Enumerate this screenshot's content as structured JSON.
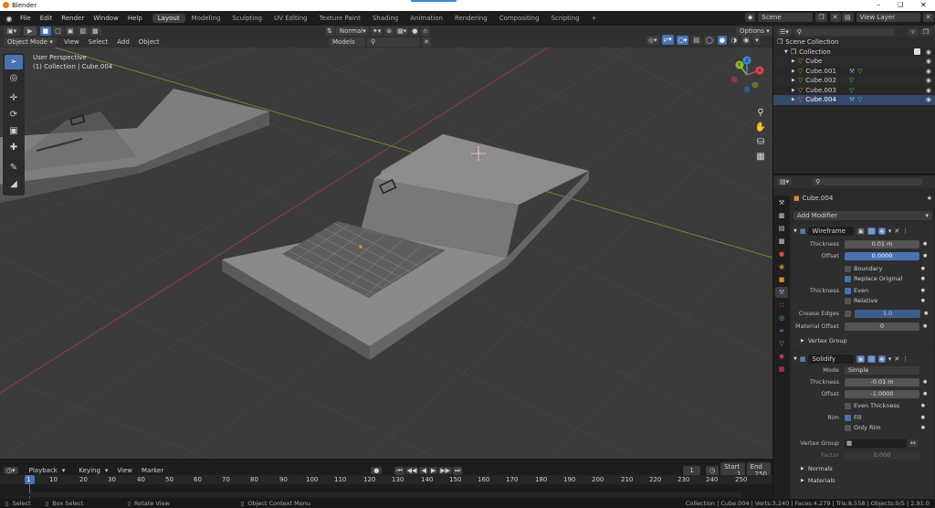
{
  "window": {
    "title": "Blender"
  },
  "topbar": {
    "menus": [
      "File",
      "Edit",
      "Render",
      "Window",
      "Help"
    ],
    "workspaces": [
      "Layout",
      "Modeling",
      "Sculpting",
      "UV Editing",
      "Texture Paint",
      "Shading",
      "Animation",
      "Rendering",
      "Compositing",
      "Scripting"
    ],
    "active_workspace": "Layout",
    "add_tab": "+",
    "scene": "Scene",
    "view_layer": "View Layer"
  },
  "viewport_header": {
    "mode": "Object Mode",
    "menus": [
      "View",
      "Select",
      "Add",
      "Object"
    ],
    "orientation": "Normal",
    "snap_target": "Models",
    "options": "Options"
  },
  "viewport": {
    "perspective_label": "User Perspective",
    "collection_label": "(1) Collection | Cube.004",
    "gizmo_axes": [
      "X",
      "Y",
      "Z"
    ]
  },
  "outliner": {
    "root": "Scene Collection",
    "collection": "Collection",
    "objects": [
      "Cube",
      "Cube.001",
      "Cube.002",
      "Cube.003",
      "Cube.004"
    ]
  },
  "properties": {
    "object_name": "Cube.004",
    "add_modifier": "Add Modifier",
    "wireframe": {
      "name": "Wireframe",
      "thickness_label": "Thickness",
      "thickness": "0.01 m",
      "offset_label": "Offset",
      "offset": "0.0000",
      "boundary": "Boundary",
      "replace_original": "Replace Original",
      "thickness2_label": "Thickness",
      "even": "Even",
      "relative": "Relative",
      "crease_label": "Crease Edges",
      "crease_value": "1.0",
      "material_offset_label": "Material Offset",
      "material_offset": "0",
      "vertex_group": "Vertex Group"
    },
    "solidify": {
      "name": "Solidify",
      "mode_label": "Mode",
      "mode": "Simple",
      "thickness_label": "Thickness",
      "thickness": "-0.01 m",
      "offset_label": "Offset",
      "offset": "-1.0000",
      "even_thickness": "Even Thickness",
      "rim_label": "Rim",
      "fill": "Fill",
      "only_rim": "Only Rim",
      "vertex_group_label": "Vertex Group",
      "factor_label": "Factor",
      "factor": "0.000",
      "normals": "Normals",
      "materials": "Materials"
    }
  },
  "timeline": {
    "menus": [
      "Playback",
      "Keying",
      "View",
      "Marker"
    ],
    "current_frame": "1",
    "start_label": "Start",
    "start": "1",
    "end_label": "End",
    "end": "250",
    "ruler": [
      "1",
      "10",
      "20",
      "30",
      "40",
      "50",
      "60",
      "70",
      "80",
      "90",
      "100",
      "110",
      "120",
      "130",
      "140",
      "150",
      "160",
      "170",
      "180",
      "190",
      "200",
      "210",
      "220",
      "230",
      "240",
      "250"
    ]
  },
  "statusbar": {
    "select": "Select",
    "box_select": "Box Select",
    "rotate_view": "Rotate View",
    "context_menu": "Object Context Menu",
    "stats": "Collection | Cube.004 | Verts:3,240 | Faces:4,279 | Tris:8,558 | Objects:0/5 | 2.91.0"
  },
  "colors": {
    "accent": "#4772b3",
    "x_axis": "#e2434b",
    "y_axis": "#8bbb29",
    "z_axis": "#3b88e0",
    "mesh_icon": "#e08a1e",
    "modifier_icon": "#7aa6e8"
  }
}
